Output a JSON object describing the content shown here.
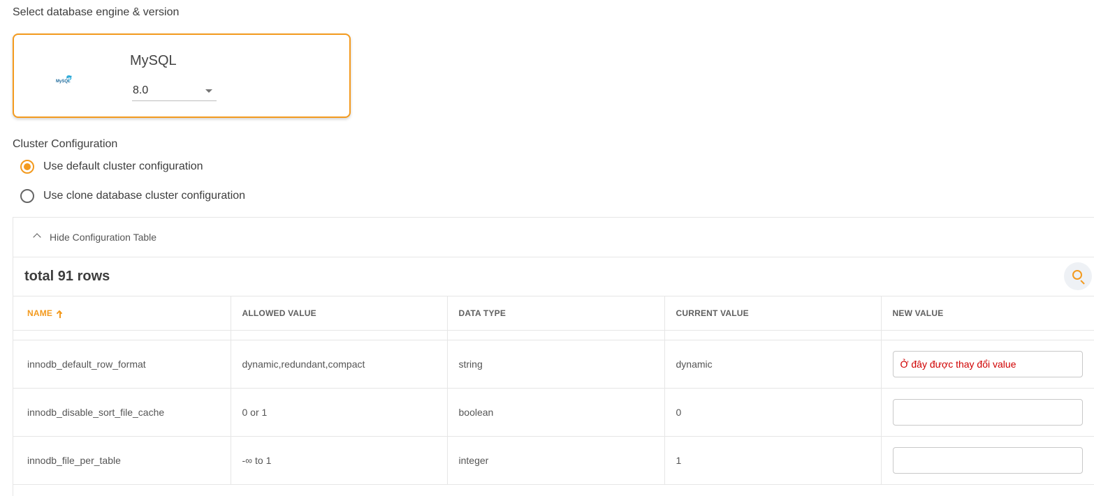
{
  "engine_section": {
    "label": "Select database engine & version"
  },
  "engine_card": {
    "logo_text": "MySQL",
    "name": "MySQL",
    "version": "8.0",
    "accent_color": "#f39a1e"
  },
  "cluster_section": {
    "label": "Cluster Configuration",
    "options": [
      {
        "label": "Use default cluster configuration",
        "checked": true
      },
      {
        "label": "Use clone database cluster configuration",
        "checked": false
      }
    ]
  },
  "config_table": {
    "toggle_label": "Hide Configuration Table",
    "total_label": "total 91 rows",
    "columns": [
      "NAME",
      "ALLOWED VALUE",
      "DATA TYPE",
      "CURRENT VALUE",
      "NEW VALUE"
    ],
    "sort_column": "NAME",
    "sort_direction": "ascending",
    "rows": [
      {
        "name": "innodb_default_row_format",
        "allowed": "dynamic,redundant,compact",
        "type": "string",
        "current": "dynamic",
        "new_value": "Ở đây được thay đổi value"
      },
      {
        "name": "innodb_disable_sort_file_cache",
        "allowed": "0 or 1",
        "type": "boolean",
        "current": "0",
        "new_value": ""
      },
      {
        "name": "innodb_file_per_table",
        "allowed": "-∞ to 1",
        "type": "integer",
        "current": "1",
        "new_value": ""
      }
    ]
  }
}
